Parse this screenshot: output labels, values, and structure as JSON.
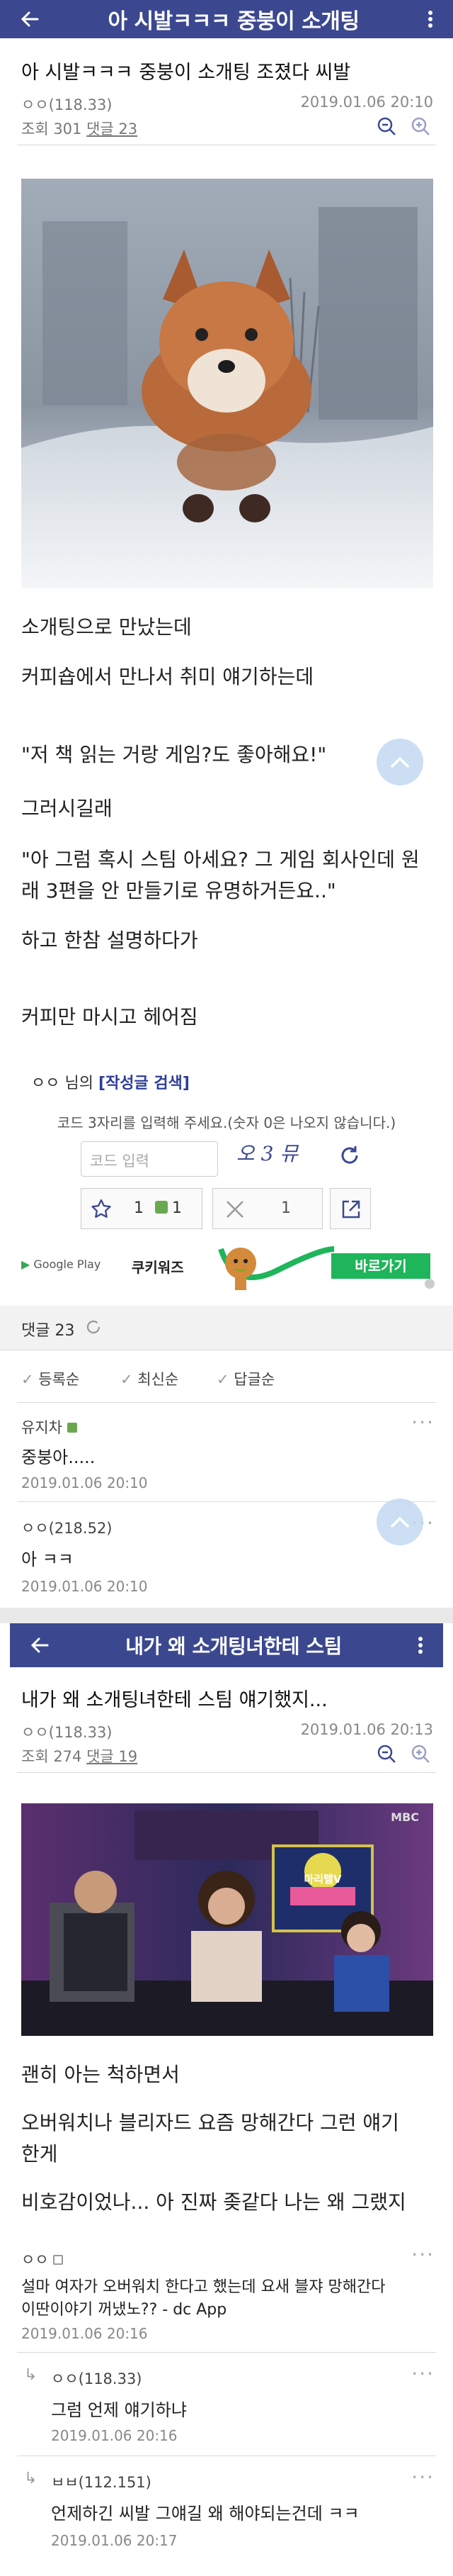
{
  "post1": {
    "header_title": "아 시발ㅋㅋㅋ 중붕이 소개팅",
    "title": "아 시발ㅋㅋㅋ 중붕이 소개팅 조졌다 씨발",
    "author": "ㅇㅇ(118.33)",
    "date": "2019.01.06 20:10",
    "views_label": "조회 301",
    "comments_label": "댓글 23",
    "body": [
      "소개팅으로 만났는데",
      "커피숍에서 만나서 취미 얘기하는데",
      "\"저 책 읽는 거랑 게임?도 좋아해요!\"",
      "그러시길래",
      "\"아 그럼 혹시 스팀 아세요? 그 게임 회사인데 원",
      "래 3편을 안 만들기로 유명하거든요..\"",
      "하고 한참 설명하다가",
      "커피만 마시고 헤어짐"
    ],
    "author_search_prefix": "ㅇㅇ 님의",
    "author_search_link": "[작성글 검색]",
    "captcha_hint": "코드 3자리를 입력해 주세요.(숫자 0은 나오지 않습니다.)",
    "captcha_placeholder": "코드 입력",
    "captcha_code": "오 3 뮤",
    "upvote_count": "1",
    "fixed_upvote_count": "1",
    "downvote_count": "1",
    "ad_store": "Google Play",
    "ad_brand": "쿠키워즈",
    "ad_button": "바로가기",
    "comments_header": "댓글 23",
    "sort_options": [
      "등록순",
      "최신순",
      "답글순"
    ],
    "comments": [
      {
        "name": "유지차",
        "text": "중붕아.....",
        "date": "2019.01.06 20:10"
      },
      {
        "name": "ㅇㅇ(218.52)",
        "text": "아 ㅋㅋ",
        "date": "2019.01.06 20:10"
      }
    ]
  },
  "post2": {
    "header_title": "내가 왜 소개팅녀한테 스팀",
    "title": "내가 왜 소개팅녀한테 스팀 얘기했지...",
    "author": "ㅇㅇ(118.33)",
    "date": "2019.01.06 20:13",
    "views_label": "조회 274",
    "comments_label": "댓글 19",
    "broadcaster_logo": "MBC",
    "show_logo": "마리텔V",
    "body": [
      "괜히 아는 척하면서",
      "오버워치나 블리자드 요즘 망해간다 그런 얘기",
      "한게",
      "비호감이었나... 아 진짜 좆같다 나는 왜 그랬지"
    ],
    "comments": [
      {
        "name": "ㅇㅇ",
        "text1": "설마 여자가 오버워치 한다고 했는데 요새 블쟈 망해간다",
        "text2": "이딴이야기 꺼냈노?? - dc App",
        "date": "2019.01.06 20:16"
      },
      {
        "name": "ㅇㅇ(118.33)",
        "text": "그럼 언제 얘기하냐",
        "date": "2019.01.06 20:16",
        "reply": true
      },
      {
        "name": "ㅂㅂ(112.151)",
        "text": "언제하긴 씨발 그얘길 왜 해야되는건데 ㅋㅋ",
        "date": "2019.01.06 20:17",
        "reply": true
      }
    ]
  },
  "colors": {
    "header_bg": "#3b4890",
    "link": "#2f3f9a",
    "ad_green": "#1fb55a"
  }
}
